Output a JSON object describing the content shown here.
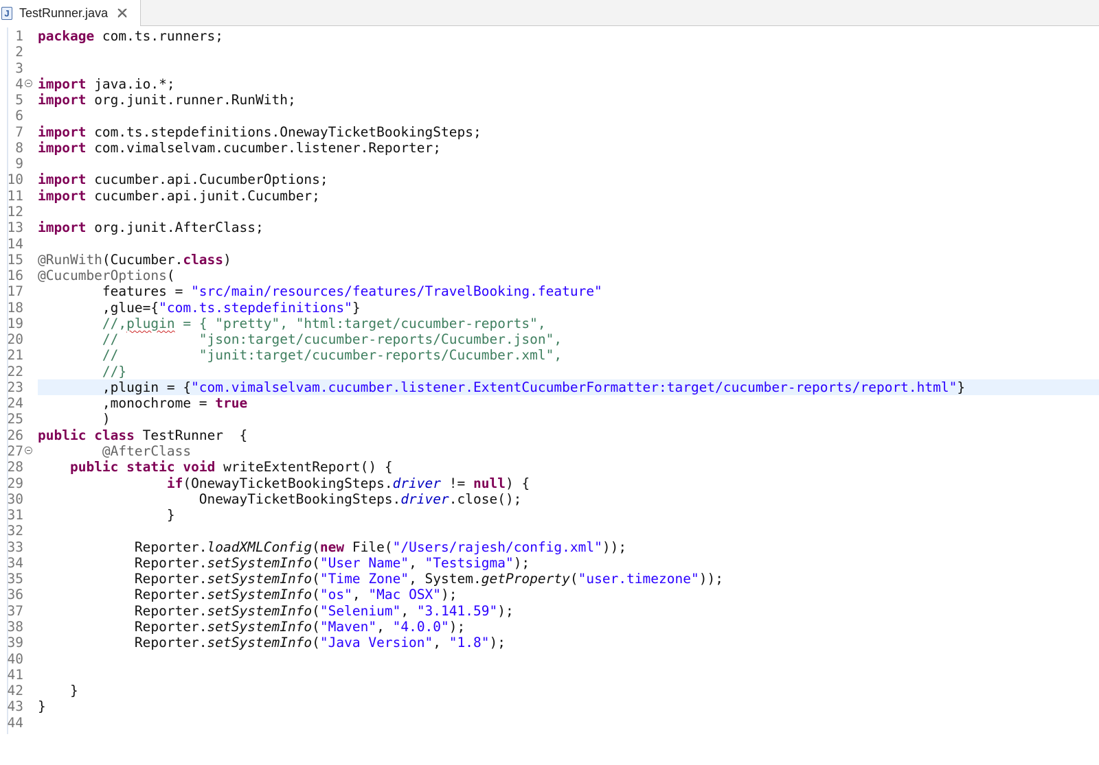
{
  "tab": {
    "icon": "java-file-icon",
    "title": "TestRunner.java",
    "close_icon": "close-icon"
  },
  "editor": {
    "current_line": 23,
    "lines": [
      {
        "n": "1",
        "segs": [
          {
            "t": "package",
            "c": "kw"
          },
          {
            "t": " com.ts.runners;"
          }
        ]
      },
      {
        "n": "2",
        "segs": []
      },
      {
        "n": "3",
        "segs": []
      },
      {
        "n": "4",
        "fold": true,
        "segs": [
          {
            "t": "import",
            "c": "kw"
          },
          {
            "t": " java.io.*;"
          }
        ]
      },
      {
        "n": "5",
        "segs": [
          {
            "t": "import",
            "c": "kw"
          },
          {
            "t": " org.junit.runner.RunWith;"
          }
        ]
      },
      {
        "n": "6",
        "segs": []
      },
      {
        "n": "7",
        "segs": [
          {
            "t": "import",
            "c": "kw"
          },
          {
            "t": " com.ts.stepdefinitions.OnewayTicketBookingSteps;"
          }
        ]
      },
      {
        "n": "8",
        "segs": [
          {
            "t": "import",
            "c": "kw"
          },
          {
            "t": " com.vimalselvam.cucumber.listener.Reporter;"
          }
        ]
      },
      {
        "n": "9",
        "segs": []
      },
      {
        "n": "10",
        "segs": [
          {
            "t": "import",
            "c": "kw"
          },
          {
            "t": " cucumber.api.CucumberOptions;"
          }
        ]
      },
      {
        "n": "11",
        "segs": [
          {
            "t": "import",
            "c": "kw"
          },
          {
            "t": " cucumber.api.junit.Cucumber;"
          }
        ]
      },
      {
        "n": "12",
        "segs": []
      },
      {
        "n": "13",
        "segs": [
          {
            "t": "import",
            "c": "kw"
          },
          {
            "t": " org.junit.AfterClass;"
          }
        ]
      },
      {
        "n": "14",
        "segs": []
      },
      {
        "n": "15",
        "segs": [
          {
            "t": "@RunWith",
            "c": "ann"
          },
          {
            "t": "(Cucumber."
          },
          {
            "t": "class",
            "c": "kw"
          },
          {
            "t": ")"
          }
        ]
      },
      {
        "n": "16",
        "segs": [
          {
            "t": "@CucumberOptions",
            "c": "ann"
          },
          {
            "t": "("
          }
        ]
      },
      {
        "n": "17",
        "segs": [
          {
            "t": "        features = "
          },
          {
            "t": "\"src/main/resources/features/TravelBooking.feature\"",
            "c": "str"
          }
        ]
      },
      {
        "n": "18",
        "segs": [
          {
            "t": "        ,glue={"
          },
          {
            "t": "\"com.ts.stepdefinitions\"",
            "c": "str"
          },
          {
            "t": "}"
          }
        ]
      },
      {
        "n": "19",
        "segs": [
          {
            "t": "        //,",
            "c": "cmt"
          },
          {
            "t": "plugin",
            "c": "cmt squig"
          },
          {
            "t": " = { \"pretty\", \"html:target/cucumber-reports\",",
            "c": "cmt"
          }
        ]
      },
      {
        "n": "20",
        "segs": [
          {
            "t": "        //          \"json:target/cucumber-reports/Cucumber.json\",",
            "c": "cmt"
          }
        ]
      },
      {
        "n": "21",
        "segs": [
          {
            "t": "        //          \"junit:target/cucumber-reports/Cucumber.xml\",",
            "c": "cmt"
          }
        ]
      },
      {
        "n": "22",
        "segs": [
          {
            "t": "        //}",
            "c": "cmt"
          }
        ]
      },
      {
        "n": "23",
        "segs": [
          {
            "t": "        ,plugin = {"
          },
          {
            "t": "\"com.vimalselvam.cucumber.listener.ExtentCucumberFormatter:target/cucumber-reports/report.html\"",
            "c": "str"
          },
          {
            "t": "}"
          }
        ]
      },
      {
        "n": "24",
        "segs": [
          {
            "t": "        ,monochrome = "
          },
          {
            "t": "true",
            "c": "kw"
          }
        ]
      },
      {
        "n": "25",
        "segs": [
          {
            "t": "        )"
          }
        ]
      },
      {
        "n": "26",
        "segs": [
          {
            "t": "public",
            "c": "kw"
          },
          {
            "t": " "
          },
          {
            "t": "class",
            "c": "kw"
          },
          {
            "t": " TestRunner  {"
          }
        ]
      },
      {
        "n": "27",
        "fold": true,
        "segs": [
          {
            "t": "        "
          },
          {
            "t": "@AfterClass",
            "c": "ann"
          }
        ]
      },
      {
        "n": "28",
        "segs": [
          {
            "t": "    "
          },
          {
            "t": "public",
            "c": "kw"
          },
          {
            "t": " "
          },
          {
            "t": "static",
            "c": "kw"
          },
          {
            "t": " "
          },
          {
            "t": "void",
            "c": "kw"
          },
          {
            "t": " writeExtentReport() {"
          }
        ]
      },
      {
        "n": "29",
        "segs": [
          {
            "t": "                "
          },
          {
            "t": "if",
            "c": "kw"
          },
          {
            "t": "(OnewayTicketBookingSteps."
          },
          {
            "t": "driver",
            "c": "fld"
          },
          {
            "t": " != "
          },
          {
            "t": "null",
            "c": "kw"
          },
          {
            "t": ") {"
          }
        ]
      },
      {
        "n": "30",
        "segs": [
          {
            "t": "                    OnewayTicketBookingSteps."
          },
          {
            "t": "driver",
            "c": "fld"
          },
          {
            "t": ".close();"
          }
        ]
      },
      {
        "n": "31",
        "segs": [
          {
            "t": "                }"
          }
        ]
      },
      {
        "n": "32",
        "segs": []
      },
      {
        "n": "33",
        "segs": [
          {
            "t": "            Reporter."
          },
          {
            "t": "loadXMLConfig",
            "c": "stat"
          },
          {
            "t": "("
          },
          {
            "t": "new",
            "c": "kw"
          },
          {
            "t": " File("
          },
          {
            "t": "\"/Users/rajesh/config.xml\"",
            "c": "str"
          },
          {
            "t": "));"
          }
        ]
      },
      {
        "n": "34",
        "segs": [
          {
            "t": "            Reporter."
          },
          {
            "t": "setSystemInfo",
            "c": "stat"
          },
          {
            "t": "("
          },
          {
            "t": "\"User Name\"",
            "c": "str"
          },
          {
            "t": ", "
          },
          {
            "t": "\"Testsigma\"",
            "c": "str"
          },
          {
            "t": ");"
          }
        ]
      },
      {
        "n": "35",
        "segs": [
          {
            "t": "            Reporter."
          },
          {
            "t": "setSystemInfo",
            "c": "stat"
          },
          {
            "t": "("
          },
          {
            "t": "\"Time Zone\"",
            "c": "str"
          },
          {
            "t": ", System."
          },
          {
            "t": "getProperty",
            "c": "stat"
          },
          {
            "t": "("
          },
          {
            "t": "\"user.timezone\"",
            "c": "str"
          },
          {
            "t": "));"
          }
        ]
      },
      {
        "n": "36",
        "segs": [
          {
            "t": "            Reporter."
          },
          {
            "t": "setSystemInfo",
            "c": "stat"
          },
          {
            "t": "("
          },
          {
            "t": "\"os\"",
            "c": "str"
          },
          {
            "t": ", "
          },
          {
            "t": "\"Mac OSX\"",
            "c": "str"
          },
          {
            "t": ");"
          }
        ]
      },
      {
        "n": "37",
        "segs": [
          {
            "t": "            Reporter."
          },
          {
            "t": "setSystemInfo",
            "c": "stat"
          },
          {
            "t": "("
          },
          {
            "t": "\"Selenium\"",
            "c": "str"
          },
          {
            "t": ", "
          },
          {
            "t": "\"3.141.59\"",
            "c": "str"
          },
          {
            "t": ");"
          }
        ]
      },
      {
        "n": "38",
        "segs": [
          {
            "t": "            Reporter."
          },
          {
            "t": "setSystemInfo",
            "c": "stat"
          },
          {
            "t": "("
          },
          {
            "t": "\"Maven\"",
            "c": "str"
          },
          {
            "t": ", "
          },
          {
            "t": "\"4.0.0\"",
            "c": "str"
          },
          {
            "t": ");"
          }
        ]
      },
      {
        "n": "39",
        "segs": [
          {
            "t": "            Reporter."
          },
          {
            "t": "setSystemInfo",
            "c": "stat"
          },
          {
            "t": "("
          },
          {
            "t": "\"Java Version\"",
            "c": "str"
          },
          {
            "t": ", "
          },
          {
            "t": "\"1.8\"",
            "c": "str"
          },
          {
            "t": ");"
          }
        ]
      },
      {
        "n": "40",
        "segs": []
      },
      {
        "n": "41",
        "segs": []
      },
      {
        "n": "42",
        "segs": [
          {
            "t": "    }"
          }
        ]
      },
      {
        "n": "43",
        "segs": [
          {
            "t": "}"
          }
        ]
      },
      {
        "n": "44",
        "segs": []
      }
    ]
  }
}
